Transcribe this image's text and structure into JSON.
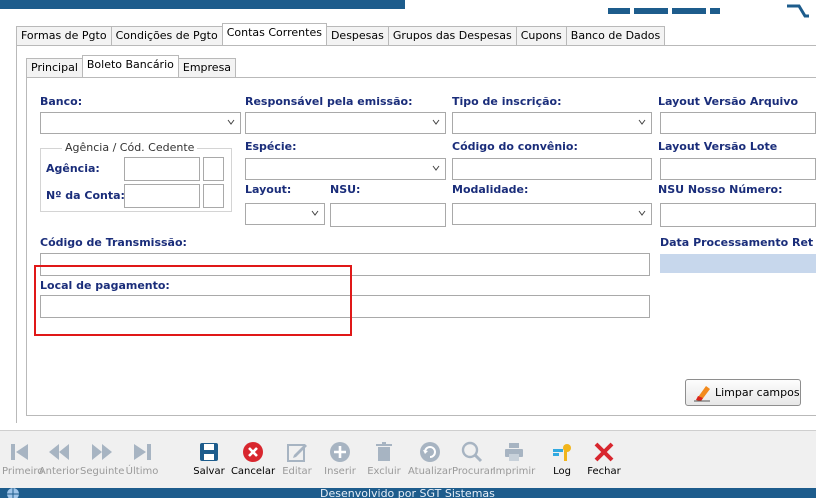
{
  "main_tabs": [
    {
      "label": "Formas de Pgto"
    },
    {
      "label": "Condições de Pgto"
    },
    {
      "label": "Contas Correntes"
    },
    {
      "label": "Despesas"
    },
    {
      "label": "Grupos das Despesas"
    },
    {
      "label": "Cupons"
    },
    {
      "label": "Banco de Dados"
    }
  ],
  "sub_tabs": [
    {
      "label": "Principal"
    },
    {
      "label": "Boleto Bancário"
    },
    {
      "label": "Empresa"
    }
  ],
  "form": {
    "banco": "Banco:",
    "responsavel": "Responsável pela emissão:",
    "tipo_inscricao": "Tipo de inscrição:",
    "layout_arquivo": "Layout Versão Arquivo",
    "agencia_group": "Agência / Cód. Cedente",
    "agencia": "Agência:",
    "numero_conta": "Nº da Conta:",
    "especie": "Espécie:",
    "codigo_convenio": "Código do convênio:",
    "layout_lote": "Layout Versão Lote",
    "layout": "Layout:",
    "nsu": "NSU:",
    "modalidade": "Modalidade:",
    "nsu_nosso_numero": "NSU Nosso Número:",
    "codigo_transmissao": "Código de Transmissão:",
    "data_processamento": "Data Processamento Ret",
    "local_pagamento": "Local de pagamento:",
    "limpar_campos": "Limpar campos"
  },
  "toolbar": {
    "primeiro": "Primeiro",
    "anterior": "Anterior",
    "seguinte": "Seguinte",
    "ultimo": "Último",
    "salvar": "Salvar",
    "cancelar": "Cancelar",
    "editar": "Editar",
    "inserir": "Inserir",
    "excluir": "Excluir",
    "atualizar": "Atualizar",
    "procurar": "Procurar",
    "imprimir": "Imprimir",
    "log": "Log",
    "fechar": "Fechar"
  },
  "status": {
    "text": "Desenvolvido por SGT Sistemas"
  },
  "colors": {
    "label_blue": "#1a2d7a",
    "highlight_red": "#e01818",
    "brand_blue": "#1d5c8c"
  }
}
